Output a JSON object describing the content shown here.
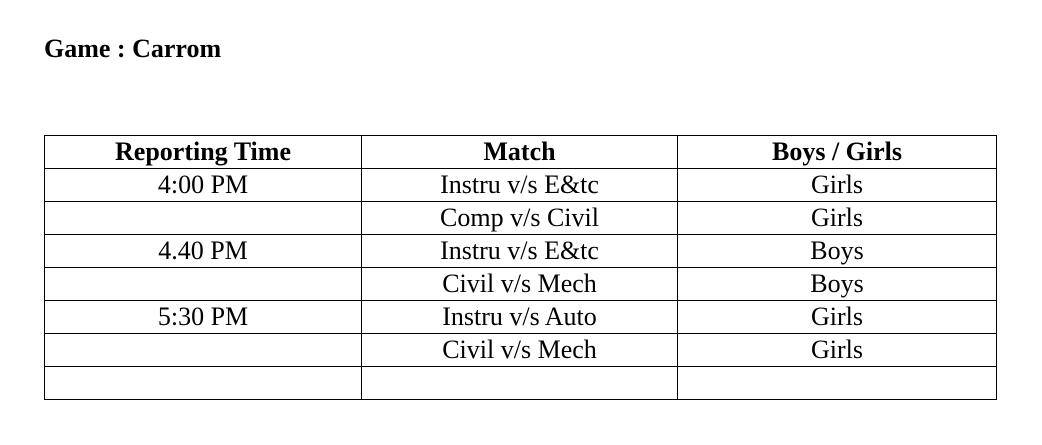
{
  "title": "Game : Carrom",
  "table": {
    "headers": [
      "Reporting Time",
      "Match",
      "Boys / Girls"
    ],
    "rows": [
      {
        "time": "4:00 PM",
        "match": "Instru v/s E&tc",
        "gender": "Girls"
      },
      {
        "time": "",
        "match": "Comp v/s Civil",
        "gender": "Girls"
      },
      {
        "time": "4.40 PM",
        "match": "Instru v/s E&tc",
        "gender": "Boys"
      },
      {
        "time": "",
        "match": "Civil v/s Mech",
        "gender": "Boys"
      },
      {
        "time": "5:30 PM",
        "match": "Instru v/s Auto",
        "gender": "Girls"
      },
      {
        "time": "",
        "match": "Civil v/s Mech",
        "gender": "Girls"
      },
      {
        "time": "",
        "match": "",
        "gender": ""
      }
    ]
  }
}
